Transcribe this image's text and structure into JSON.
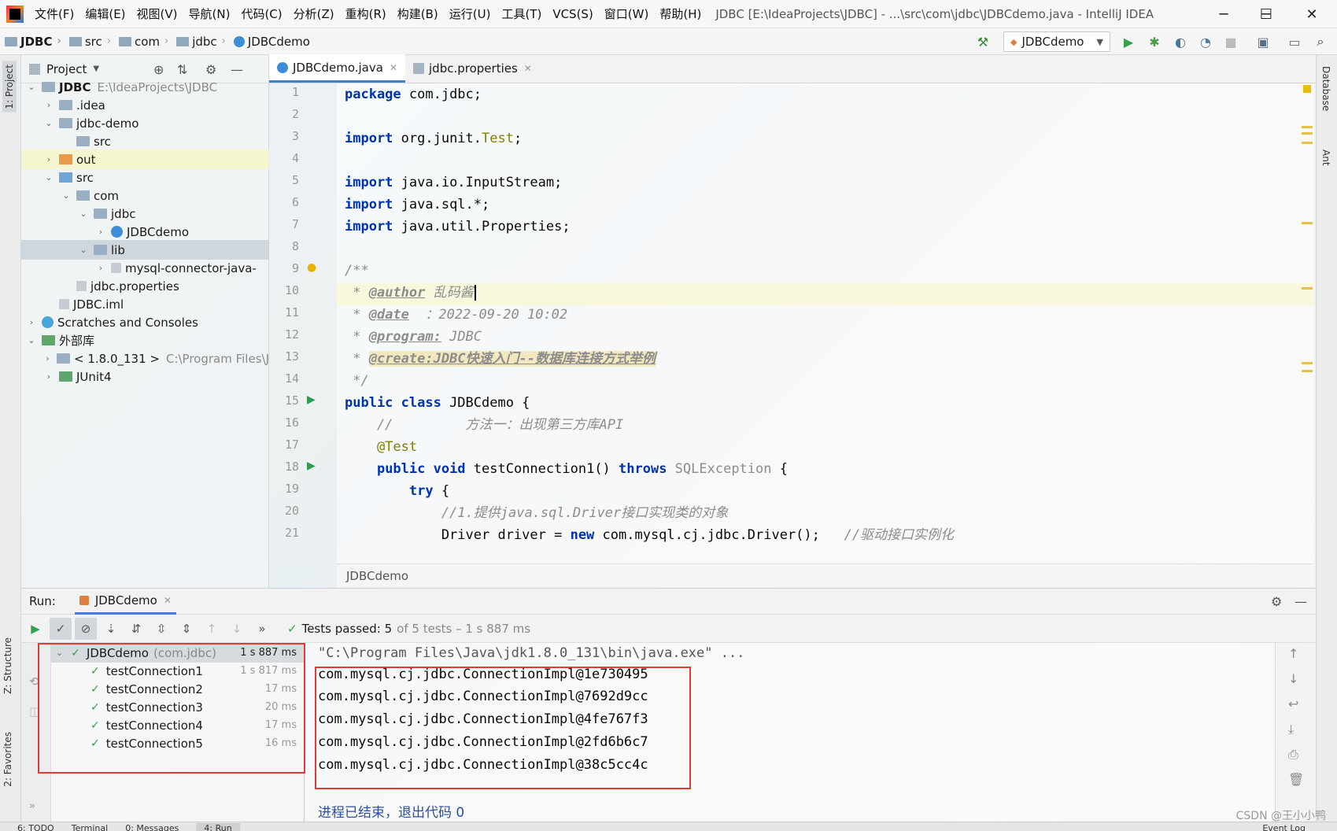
{
  "menubar": {
    "items": [
      "文件(F)",
      "编辑(E)",
      "视图(V)",
      "导航(N)",
      "代码(C)",
      "分析(Z)",
      "重构(R)",
      "构建(B)",
      "运行(U)",
      "工具(T)",
      "VCS(S)",
      "窗口(W)",
      "帮助(H)"
    ],
    "window_title": "JDBC [E:\\IdeaProjects\\JDBC] - ...\\src\\com\\jdbc\\JDBCdemo.java - IntelliJ IDEA",
    "minimize": "─",
    "maximize": "☐",
    "close": "✕"
  },
  "navbar": {
    "crumbs": [
      "JDBC",
      "src",
      "com",
      "jdbc",
      "JDBCdemo"
    ],
    "run_config": "JDBCdemo"
  },
  "left_stripe": {
    "project_tab": "1: Project",
    "structure_tab": "Z: Structure",
    "favorites_tab": "2: Favorites"
  },
  "project_panel": {
    "title": "Project",
    "tree": [
      {
        "label": "JDBC",
        "hint": "E:\\IdeaProjects\\JDBC"
      },
      {
        "label": ".idea"
      },
      {
        "label": "jdbc-demo"
      },
      {
        "label": "src"
      },
      {
        "label": "out"
      },
      {
        "label": "src"
      },
      {
        "label": "com"
      },
      {
        "label": "jdbc"
      },
      {
        "label": "JDBCdemo"
      },
      {
        "label": "lib"
      },
      {
        "label": "mysql-connector-java-"
      },
      {
        "label": "jdbc.properties"
      },
      {
        "label": "JDBC.iml"
      },
      {
        "label": "Scratches and Consoles"
      },
      {
        "label": "外部库"
      },
      {
        "label": "< 1.8.0_131 >",
        "hint": "C:\\Program Files\\J"
      },
      {
        "label": "JUnit4"
      }
    ]
  },
  "editor": {
    "tabs": [
      {
        "label": "JDBCdemo.java"
      },
      {
        "label": "jdbc.properties"
      }
    ],
    "line_numbers": [
      "1",
      "2",
      "3",
      "4",
      "5",
      "6",
      "7",
      "8",
      "9",
      "10",
      "11",
      "12",
      "13",
      "14",
      "15",
      "16",
      "17",
      "18",
      "19",
      "20",
      "21"
    ],
    "code": {
      "l1_kw": "package",
      "l1_rest": " com.jdbc;",
      "l3_kw": "import",
      "l3_rest": " org.junit.",
      "l3_cls": "Test",
      "l3_end": ";",
      "l5_kw": "import",
      "l5_rest": " java.io.InputStream;",
      "l6_kw": "import",
      "l6_rest": " java.sql.*;",
      "l7_kw": "import",
      "l7_rest": " java.util.Properties;",
      "l9": "/**",
      "l10_star": " * ",
      "l10_tag": "@author",
      "l10_val": " 乱码酱",
      "l11_star": " * ",
      "l11_tag": "@date",
      "l11_val": "  ：2022-09-20 10:02",
      "l12_star": " * ",
      "l12_tag": "@program:",
      "l12_val": " JDBC",
      "l13_star": " * ",
      "l13_tag": "@create:JDBC快速入门--数据库连接方式举例",
      "l14": " */",
      "l15_kw": "public class",
      "l15_rest": " JDBCdemo {",
      "l16": "    //         方法一：出现第三方库API",
      "l17": "    @Test",
      "l18_indent": "    ",
      "l18_kw": "public void",
      "l18_rest": " testConnection1() ",
      "l18_kw2": "throws",
      "l18_exc": " SQLException",
      "l18_end": " {",
      "l19_indent": "        ",
      "l19_kw": "try",
      "l19_rest": " {",
      "l20": "            //1.提供java.sql.Driver接口实现类的对象",
      "l21_a": "            Driver driver = ",
      "l21_kw": "new",
      "l21_b": " com.mysql.cj.jdbc.Driver();   ",
      "l21_cm": "//驱动接口实例化"
    },
    "footer_breadcrumb": "JDBCdemo"
  },
  "right_stripe": {
    "database_tab": "Database",
    "ant_tab": "Ant"
  },
  "run_panel": {
    "label": "Run:",
    "tab": "JDBCdemo",
    "status_main": "Tests passed: 5",
    "status_rest": "of 5 tests – 1 s 887 ms",
    "tests": [
      {
        "name": "JDBCdemo",
        "pkg": "(com.jdbc)",
        "time": "1 s 887 ms"
      },
      {
        "name": "testConnection1",
        "time": "1 s 817 ms"
      },
      {
        "name": "testConnection2",
        "time": "17 ms"
      },
      {
        "name": "testConnection3",
        "time": "20 ms"
      },
      {
        "name": "testConnection4",
        "time": "17 ms"
      },
      {
        "name": "testConnection5",
        "time": "16 ms"
      }
    ],
    "console": [
      "\"C:\\Program Files\\Java\\jdk1.8.0_131\\bin\\java.exe\" ...",
      "com.mysql.cj.jdbc.ConnectionImpl@1e730495",
      "com.mysql.cj.jdbc.ConnectionImpl@7692d9cc",
      "com.mysql.cj.jdbc.ConnectionImpl@4fe767f3",
      "com.mysql.cj.jdbc.ConnectionImpl@2fd6b6c7",
      "com.mysql.cj.jdbc.ConnectionImpl@38c5cc4c",
      "进程已结束，退出代码 0"
    ]
  },
  "statusbar": {
    "items": [
      "6: TODO",
      "Terminal",
      "0: Messages",
      "4: Run"
    ],
    "event_log": "Event Log"
  },
  "watermark": "CSDN @王小小鸭"
}
